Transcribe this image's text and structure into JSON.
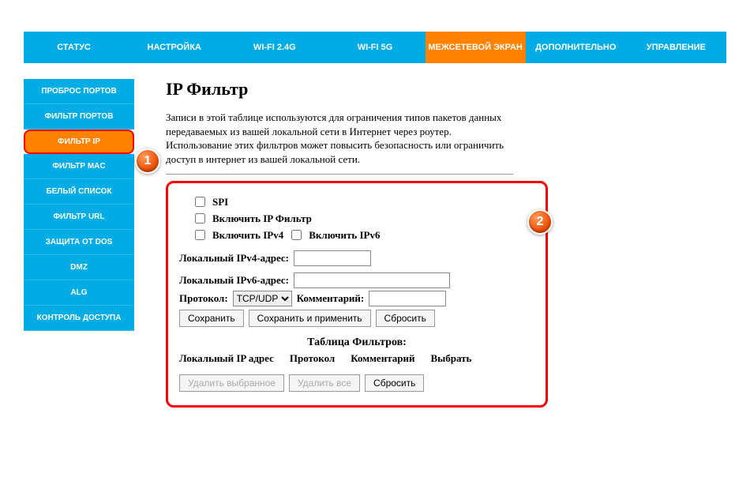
{
  "topnav": [
    {
      "label": "СТАТУС"
    },
    {
      "label": "НАСТРОЙКА"
    },
    {
      "label": "WI-FI 2.4G"
    },
    {
      "label": "WI-FI 5G"
    },
    {
      "label": "МЕЖСЕТЕВОЙ ЭКРАН"
    },
    {
      "label": "ДОПОЛНИТЕЛЬНО"
    },
    {
      "label": "УПРАВЛЕНИЕ"
    }
  ],
  "sidebar": [
    {
      "label": "ПРОБРОС ПОРТОВ"
    },
    {
      "label": "ФИЛЬТР ПОРТОВ"
    },
    {
      "label": "ФИЛЬТР IP"
    },
    {
      "label": "ФИЛЬТР MAC"
    },
    {
      "label": "БЕЛЫЙ СПИСОК"
    },
    {
      "label": "ФИЛЬТР URL"
    },
    {
      "label": "ЗАЩИТА ОТ DOS"
    },
    {
      "label": "DMZ"
    },
    {
      "label": "ALG"
    },
    {
      "label": "КОНТРОЛЬ ДОСТУПА"
    }
  ],
  "page": {
    "title": "IP Фильтр",
    "description": "Записи в этой таблице используются для ограничения типов пакетов данных передаваемых из вашей локальной сети в Интернет через роутер. Использование этих фильтров может повысить безопасность или ограничить доступ в интернет из вашей локальной сети."
  },
  "form": {
    "spi": "SPI",
    "enable_ip_filter": "Включить IP Фильтр",
    "enable_ipv4": "Включить IPv4",
    "enable_ipv6": "Включить IPv6",
    "local_ipv4_label": "Локальный IPv4-адрес:",
    "local_ipv6_label": "Локальный IPv6-адрес:",
    "protocol_label": "Протокол:",
    "protocol_value": "TCP/UDP",
    "comment_label": "Комментарий:",
    "save": "Сохранить",
    "save_apply": "Сохранить и применить",
    "reset": "Сбросить"
  },
  "table": {
    "title": "Таблица Фильтров:",
    "headers": [
      "Локальный IP адрес",
      "Протокол",
      "Комментарий",
      "Выбрать"
    ],
    "delete_selected": "Удалить выбранное",
    "delete_all": "Удалить все",
    "reset": "Сбросить"
  },
  "badges": {
    "one": "1",
    "two": "2"
  }
}
